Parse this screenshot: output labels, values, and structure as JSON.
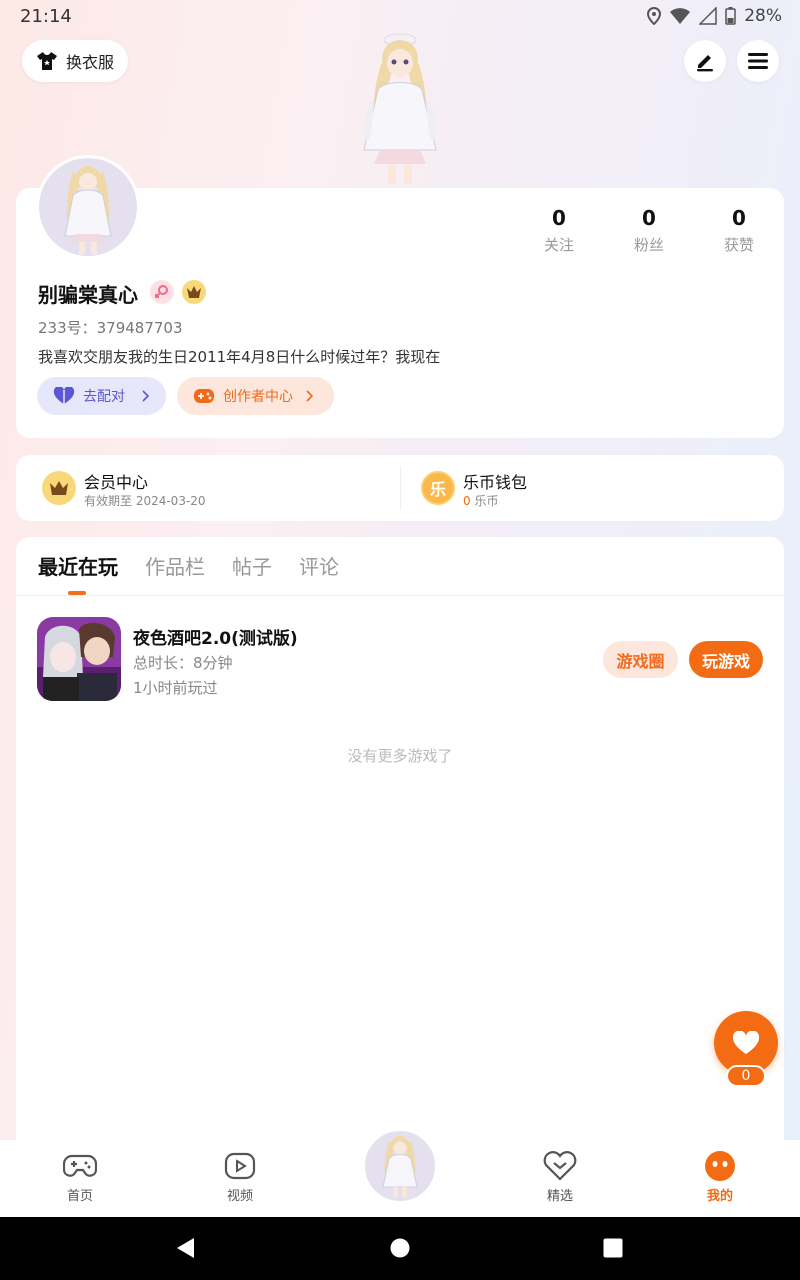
{
  "status": {
    "time": "21:14",
    "battery": "28%"
  },
  "header": {
    "outfit_label": "换衣服",
    "edit_icon": "pen-icon",
    "menu_icon": "menu-icon"
  },
  "profile": {
    "stats": [
      {
        "value": "0",
        "label": "关注"
      },
      {
        "value": "0",
        "label": "粉丝"
      },
      {
        "value": "0",
        "label": "获赞"
      }
    ],
    "name": "别骗棠真心",
    "uid": "233号：379487703",
    "bio": "我喜欢交朋友我的生日2011年4月8日什么时候过年？我现在",
    "match_label": "去配对",
    "creator_label": "创作者中心"
  },
  "membership": {
    "title": "会员中心",
    "expiry": "有效期至 2024-03-20",
    "wallet_title": "乐币钱包",
    "wallet_amount": "0",
    "wallet_unit": " 乐币",
    "coin_char": "乐"
  },
  "tabs": [
    "最近在玩",
    "作品栏",
    "帖子",
    "评论"
  ],
  "recent_game": {
    "title": "夜色酒吧2.0(测试版)",
    "duration": "总时长：8分钟",
    "last_played": "1小时前玩过",
    "circle_label": "游戏圈",
    "play_label": "玩游戏"
  },
  "empty_text": "没有更多游戏了",
  "favorite": {
    "count": "0"
  },
  "bottom_nav": [
    {
      "label": "首页",
      "icon": "gamepad-icon"
    },
    {
      "label": "视频",
      "icon": "play-icon"
    },
    {
      "label": "精选",
      "icon": "heart-chat-icon"
    },
    {
      "label": "我的",
      "icon": "smiley-icon"
    }
  ],
  "colors": {
    "accent": "#f36c13",
    "match": "#5a56d4"
  }
}
